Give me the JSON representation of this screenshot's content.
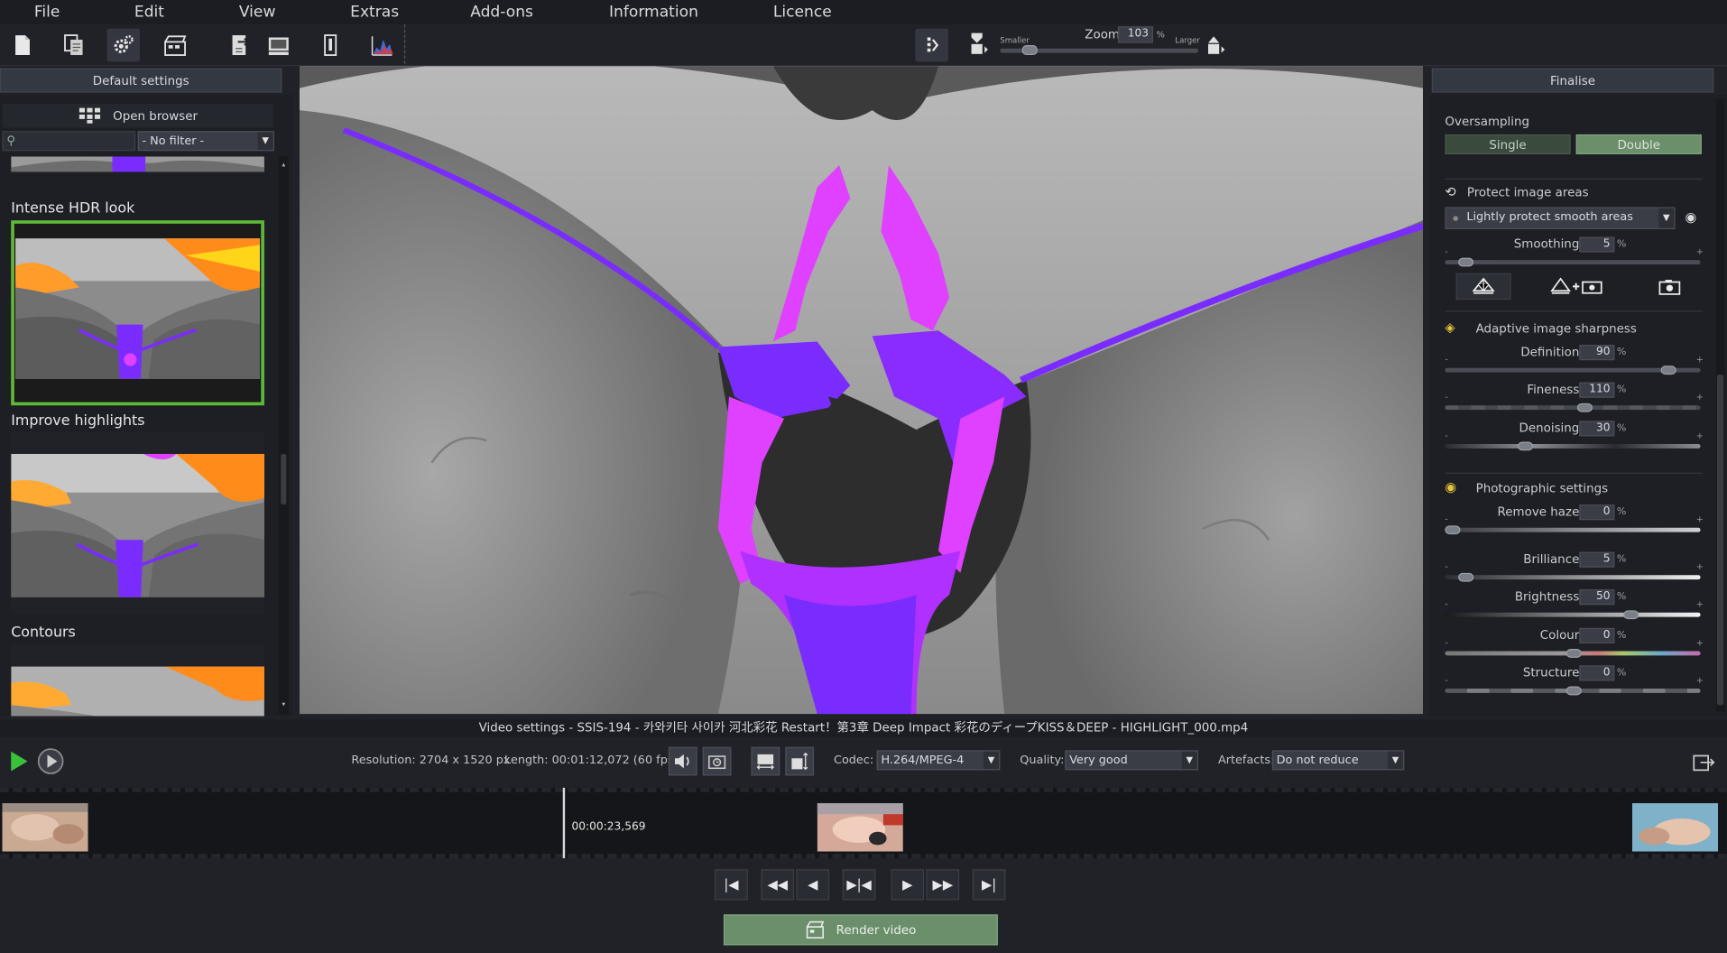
{
  "menu": {
    "file": "File",
    "edit": "Edit",
    "view": "View",
    "extras": "Extras",
    "addons": "Add-ons",
    "information": "Information",
    "licence": "Licence"
  },
  "toolbar": {
    "icons": [
      "new-document-icon",
      "copy-document-icon",
      "settings-gear-icon",
      "film-clapper-icon",
      "export-icon",
      "monitor-icon",
      "thermometer-icon",
      "histogram-icon",
      "split-view-icon"
    ],
    "zoom_label": "Zoom",
    "zoom_value": "103",
    "zoom_unit": "%",
    "smaller_label": "Smaller",
    "larger_label": "Larger",
    "zoom_level": 0.12
  },
  "left_panel": {
    "header": "Default settings",
    "open_browser": "Open browser",
    "filter_placeholder": "",
    "filter_value": "- No filter -",
    "presets": [
      {
        "title": "Intense HDR look"
      },
      {
        "title": "Improve highlights"
      },
      {
        "title": "Contours"
      }
    ]
  },
  "right_panel": {
    "header": "Finalise",
    "oversampling_label": "Oversampling",
    "single_label": "Single",
    "double_label": "Double",
    "protect_label": "Protect image areas",
    "protect_option": "Lightly protect smooth areas",
    "smoothing_label": "Smoothing",
    "smoothing_value": "5",
    "sharpness_label": "Adaptive image sharpness",
    "definition_label": "Definition",
    "definition_value": "90",
    "fineness_label": "Fineness",
    "fineness_value": "110",
    "denoising_label": "Denoising",
    "denoising_value": "30",
    "photo_label": "Photographic settings",
    "haze_label": "Remove haze",
    "haze_value": "0",
    "brilliance_label": "Brilliance",
    "brilliance_value": "5",
    "brightness_label": "Brightness",
    "brightness_value": "50",
    "colour_label": "Colour",
    "colour_value": "0",
    "structure_label": "Structure",
    "structure_value": "0",
    "pct": "%",
    "minus": "-",
    "plus": "+"
  },
  "video": {
    "title": "Video settings - SSIS-194 - 카와키타 사이카 河北彩花 Restart！第3章 Deep Impact 彩花のディープKISS＆DEEP -  HIGHLIGHT_000.mp4",
    "resolution": "Resolution: 2704 x 1520 px",
    "length": "Length: 00:01:12,072 (60 fps)",
    "codec_label": "Codec:",
    "codec_value": "H.264/MPEG-4",
    "quality_label": "Quality:",
    "quality_value": "Very good",
    "artefacts_label": "Artefacts:",
    "artefacts_value": "Do not reduce",
    "timecode": "00:00:23,569",
    "render_label": "Render video"
  },
  "colors": {
    "accent_green": "#6b8f6b",
    "selected_border": "#5fb83a",
    "overlay_purple": "#7a2cff",
    "overlay_magenta": "#e040ff"
  }
}
